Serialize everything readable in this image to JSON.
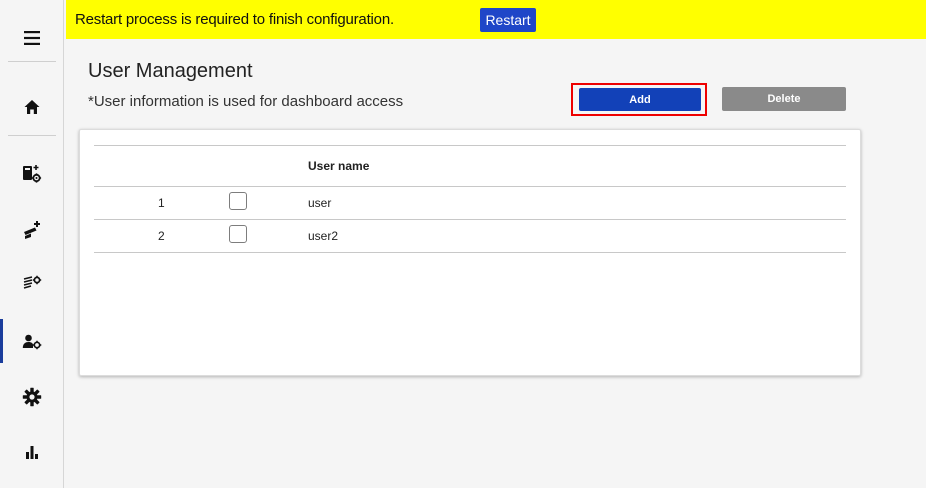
{
  "banner": {
    "message": "Restart process is required to finish configuration.",
    "restart_label": "Restart",
    "background": "#ffff00",
    "button_color": "#1f46c8"
  },
  "sidebar": {
    "items": [
      {
        "name": "menu",
        "icon": "hamburger-menu-icon"
      },
      {
        "name": "home",
        "icon": "home-icon"
      },
      {
        "name": "device-settings",
        "icon": "device-settings-icon"
      },
      {
        "name": "add-camera",
        "icon": "add-camera-icon"
      },
      {
        "name": "list-settings",
        "icon": "list-settings-icon"
      },
      {
        "name": "user-management",
        "icon": "user-settings-icon",
        "active": true
      },
      {
        "name": "settings",
        "icon": "gear-icon"
      },
      {
        "name": "statistics",
        "icon": "bar-chart-icon"
      }
    ],
    "active_color": "#1a3d9c"
  },
  "page": {
    "title": "User Management",
    "subtitle": "*User information is used for dashboard access",
    "add_label": "Add",
    "delete_label": "Delete",
    "add_color": "#1241b8",
    "delete_color": "#8a8a8a",
    "highlight_color": "#ee0000"
  },
  "table": {
    "columns": [
      "",
      "",
      "User name"
    ],
    "rows": [
      {
        "index": "1",
        "checked": false,
        "name": "user"
      },
      {
        "index": "2",
        "checked": false,
        "name": "user2"
      }
    ]
  }
}
